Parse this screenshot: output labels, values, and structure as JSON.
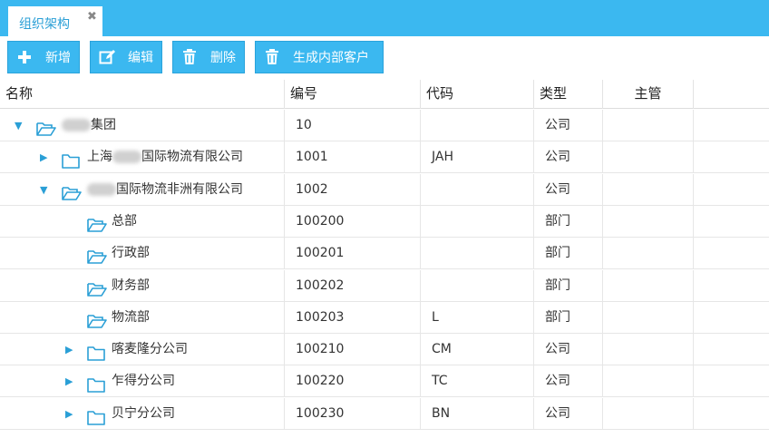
{
  "tab": {
    "title": "组织架构",
    "close": "✖"
  },
  "toolbar": {
    "add_label": "新增",
    "edit_label": "编辑",
    "delete_label": "删除",
    "gen_label": "生成内部客户"
  },
  "columns": {
    "name": "名称",
    "code": "编号",
    "short": "代码",
    "type": "类型",
    "manager": "主管"
  },
  "rows": [
    {
      "name_pre": "",
      "name": "集团",
      "code": "10",
      "short": "",
      "type": "公司",
      "level": 0,
      "toggle": "expanded",
      "redacted": true
    },
    {
      "name_pre": "上海",
      "name": "国际物流有限公司",
      "code": "1001",
      "short": "JAH",
      "type": "公司",
      "level": 1,
      "toggle": "collapsed",
      "redacted": true
    },
    {
      "name_pre": "",
      "name": "国际物流非洲有限公司",
      "code": "1002",
      "short": "",
      "type": "公司",
      "level": 1,
      "toggle": "expanded",
      "redacted": true
    },
    {
      "name_pre": "",
      "name": "总部",
      "code": "100200",
      "short": "",
      "type": "部门",
      "level": 2,
      "toggle": "none",
      "redacted": false
    },
    {
      "name_pre": "",
      "name": "行政部",
      "code": "100201",
      "short": "",
      "type": "部门",
      "level": 2,
      "toggle": "none",
      "redacted": false
    },
    {
      "name_pre": "",
      "name": "财务部",
      "code": "100202",
      "short": "",
      "type": "部门",
      "level": 2,
      "toggle": "none",
      "redacted": false
    },
    {
      "name_pre": "",
      "name": "物流部",
      "code": "100203",
      "short": "L",
      "type": "部门",
      "level": 2,
      "toggle": "none",
      "redacted": false
    },
    {
      "name_pre": "",
      "name": "喀麦隆分公司",
      "code": "100210",
      "short": "CM",
      "type": "公司",
      "level": 2,
      "toggle": "collapsed",
      "redacted": false
    },
    {
      "name_pre": "",
      "name": "乍得分公司",
      "code": "100220",
      "short": "TC",
      "type": "公司",
      "level": 2,
      "toggle": "collapsed",
      "redacted": false
    },
    {
      "name_pre": "",
      "name": "贝宁分公司",
      "code": "100230",
      "short": "BN",
      "type": "公司",
      "level": 2,
      "toggle": "collapsed",
      "redacted": false
    }
  ],
  "colors": {
    "accent": "#3bb8f0",
    "icon": "#2a9fd6"
  }
}
